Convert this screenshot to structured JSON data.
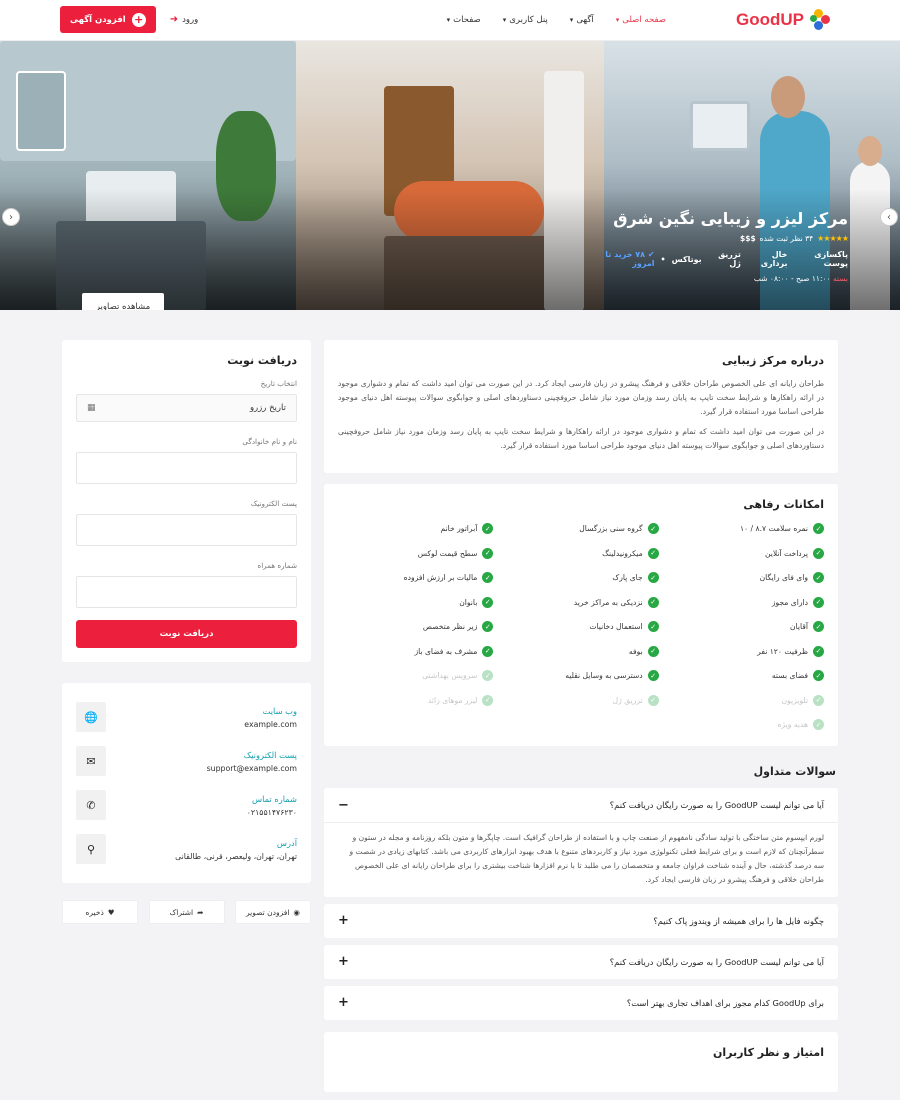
{
  "header": {
    "brand": "GoodUP",
    "nav": [
      {
        "label": "صفحه اصلی",
        "active": true
      },
      {
        "label": "آگهی",
        "active": false
      },
      {
        "label": "پنل کاربری",
        "active": false
      },
      {
        "label": "صفحات",
        "active": false
      }
    ],
    "login_label": "ورود",
    "add_listing_label": "افزودن آگهی"
  },
  "hero": {
    "title": "مرکز لیزر و زیبایی نگین شرق",
    "rating_text": "۳۴ نظر ثبت شده",
    "price": "$$$",
    "stars": "★★★★★",
    "tags": [
      "پاکسازی پوست",
      "خال برداری",
      "تزریق ژل",
      "بوتاکس"
    ],
    "buyers": "۷۸ خرید تا امروز",
    "hours_status": "بسته",
    "hours": "۱۱:۰۰ صبح - ۰۸:۰۰ شب",
    "view_photos_label": "مشاهده تصاویر"
  },
  "about": {
    "title": "درباره مرکز زیبایی",
    "p1": "طراحان رایانه ای علی الخصوص طراحان خلاقی و فرهنگ پیشرو در زبان فارسی ایجاد کرد. در این صورت می توان امید داشت که تمام و دشواری موجود در ارائه راهکارها و شرایط سخت تایپ به پایان رسد وزمان مورد نیاز شامل حروفچینی دستاوردهای اصلی و جوابگوی سوالات پیوسته اهل دنیای موجود طراحی اساسا مورد استفاده قرار گیرد.",
    "p2": "در این صورت می توان امید داشت که تمام و دشواری موجود در ارائه راهکارها و شرایط سخت تایپ به پایان رسد وزمان مورد نیاز شامل حروفچینی دستاوردهای اصلی و جوابگوی سوالات پیوسته اهل دنیای موجود طراحی اساسا مورد استفاده قرار گیرد."
  },
  "amenities": {
    "title": "امکانات رفاهی",
    "items": [
      {
        "label": "نمره سلامت ۸.۷ / ۱۰",
        "on": true
      },
      {
        "label": "گروه سنی بزرگسال",
        "on": true
      },
      {
        "label": "آبراتور خانم",
        "on": true
      },
      {
        "label": "پرداخت آنلاین",
        "on": true
      },
      {
        "label": "میکرونیدلینگ",
        "on": true
      },
      {
        "label": "سطح قیمت لوکس",
        "on": true
      },
      {
        "label": "وای فای رایگان",
        "on": true
      },
      {
        "label": "جای پارک",
        "on": true
      },
      {
        "label": "مالیات بر ارزش افزوده",
        "on": true
      },
      {
        "label": "دارای مجوز",
        "on": true
      },
      {
        "label": "نزدیکی به مراکز خرید",
        "on": true
      },
      {
        "label": "بانوان",
        "on": true
      },
      {
        "label": "آقایان",
        "on": true
      },
      {
        "label": "استعمال دخانیات",
        "on": true
      },
      {
        "label": "زیر نظر متخصص",
        "on": true
      },
      {
        "label": "ظرفیت ۱۲۰ نفر",
        "on": true
      },
      {
        "label": "بوفه",
        "on": true
      },
      {
        "label": "مشرف به فضای باز",
        "on": true
      },
      {
        "label": "فضای بسته",
        "on": true
      },
      {
        "label": "دسترسی به وسایل نقلیه",
        "on": true
      },
      {
        "label": "سرویس بهداشتی",
        "on": false
      },
      {
        "label": "تلویزیون",
        "on": false
      },
      {
        "label": "تزریق ژل",
        "on": false
      },
      {
        "label": "لیزر موهای زائد",
        "on": false
      },
      {
        "label": "هدیه ویژه",
        "on": false
      }
    ]
  },
  "faq": {
    "title": "سوالات متداول",
    "items": [
      {
        "q": "آیا می توانم لیست GoodUP را به صورت رایگان دریافت کنم؟",
        "open": true,
        "a": "لورم ایپسوم متن ساختگی با تولید سادگی نامفهوم از صنعت چاپ و با استفاده از طراحان گرافیک است. چاپگرها و متون بلکه روزنامه و مجله در ستون و سطرآنچنان که لازم است و برای شرایط فعلی تکنولوژی مورد نیاز و کاربردهای متنوع با هدف بهبود ابزارهای کاربردی می باشد. کتابهای زیادی در شصت و سه درصد گذشته، حال و آینده شناخت فراوان جامعه و متخصصان را می طلبد تا با نرم افزارها شناخت بیشتری را برای طراحان رایانه ای علی الخصوص طراحان خلاقی و فرهنگ پیشرو در زبان فارسی ایجاد کرد."
      },
      {
        "q": "چگونه فایل ها را برای همیشه از ویندوز پاک کنیم؟",
        "open": false,
        "a": ""
      },
      {
        "q": "آیا می توانم لیست GoodUP را به صورت رایگان دریافت کنم؟",
        "open": false,
        "a": ""
      },
      {
        "q": "برای GoodUp کدام مجوز برای اهداف تجاری بهتر است؟",
        "open": false,
        "a": ""
      }
    ]
  },
  "reviews": {
    "title": "امتیاز و نظر کاربران"
  },
  "appointment": {
    "title": "دریافت نوبت",
    "date_label": "انتخاب تاریخ",
    "date_value": "تاریخ رزرو",
    "name_label": "نام و نام خانوادگی",
    "email_label": "پست الکترونیک",
    "phone_label": "شماره همراه",
    "submit_label": "دریافت نوبت"
  },
  "contact": [
    {
      "title": "وب سایت",
      "value": "example.com",
      "icon": "globe-icon",
      "glyph": "🌐"
    },
    {
      "title": "پست الکترونیک",
      "value": "support@example.com",
      "icon": "mail-icon",
      "glyph": "✉"
    },
    {
      "title": "شماره تماس",
      "value": "۰۲۱۵۵۱۴۷۶۲۳۰",
      "icon": "phone-icon",
      "glyph": "✆"
    },
    {
      "title": "آدرس",
      "value": "تهران، تهران، ولیعصر، قرنی، طالقانی",
      "icon": "location-pin-icon",
      "glyph": "⚲"
    }
  ],
  "actions": {
    "add_photo": "افزودن تصویر",
    "share": "اشتراک",
    "save": "ذخیره"
  },
  "colors": {
    "accent": "#ec1f3c",
    "check": "#27a844",
    "link": "#12a0b0"
  }
}
